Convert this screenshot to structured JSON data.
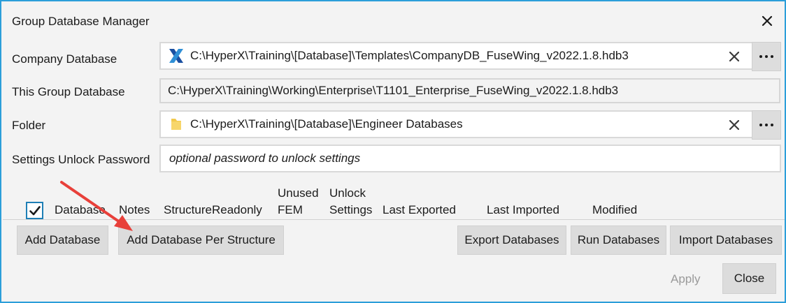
{
  "window": {
    "title": "Group Database Manager"
  },
  "fields": {
    "company_db": {
      "label": "Company Database",
      "value": "C:\\HyperX\\Training\\[Database]\\Templates\\CompanyDB_FuseWing_v2022.1.8.hdb3",
      "icon": "hyperx-logo-icon"
    },
    "group_db": {
      "label": "This Group Database",
      "value": "C:\\HyperX\\Training\\Working\\Enterprise\\T1101_Enterprise_FuseWing_v2022.1.8.hdb3"
    },
    "folder": {
      "label": "Folder",
      "value": "C:\\HyperX\\Training\\[Database]\\Engineer Databases",
      "icon": "folder-icon"
    },
    "password": {
      "label": "Settings Unlock Password",
      "placeholder": "optional password to unlock settings"
    }
  },
  "table": {
    "select_all_checked": true,
    "columns": {
      "database": "Database",
      "notes": "Notes",
      "structure_readonly": "StructureReadonly",
      "unused_fem_line1": "Unused",
      "unused_fem_line2": "FEM",
      "unlock_settings_line1": "Unlock",
      "unlock_settings_line2": "Settings",
      "last_exported": "Last Exported",
      "last_imported": "Last Imported",
      "modified": "Modified"
    }
  },
  "buttons": {
    "add_database": "Add Database",
    "add_database_per_structure": "Add Database Per Structure",
    "export_databases": "Export Databases",
    "run_databases": "Run Databases",
    "import_databases": "Import Databases",
    "apply": "Apply",
    "close": "Close"
  },
  "colors": {
    "window_border": "#2b9ed9",
    "annotation_arrow": "#e8403a",
    "logo_blue": "#1a4fa0"
  }
}
